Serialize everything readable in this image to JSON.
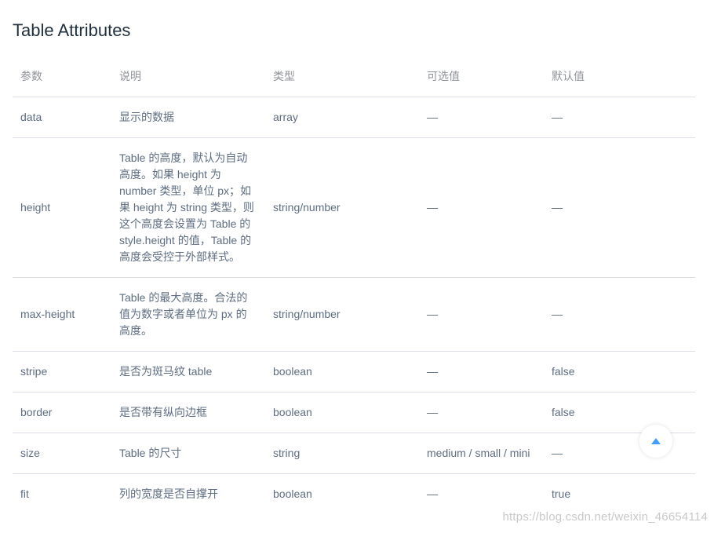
{
  "page": {
    "title": "Table Attributes",
    "watermark": "https://blog.csdn.net/weixin_46654114"
  },
  "table": {
    "headers": [
      "参数",
      "说明",
      "类型",
      "可选值",
      "默认值"
    ],
    "rows": [
      [
        "data",
        "显示的数据",
        "array",
        "—",
        "—"
      ],
      [
        "height",
        "Table 的高度，默认为自动高度。如果 height 为 number 类型，单位 px；如果 height 为 string 类型，则这个高度会设置为 Table 的 style.height 的值，Table 的高度会受控于外部样式。",
        "string/number",
        "—",
        "—"
      ],
      [
        "max-height",
        "Table 的最大高度。合法的值为数字或者单位为 px 的高度。",
        "string/number",
        "—",
        "—"
      ],
      [
        "stripe",
        "是否为斑马纹 table",
        "boolean",
        "—",
        "false"
      ],
      [
        "border",
        "是否带有纵向边框",
        "boolean",
        "—",
        "false"
      ],
      [
        "size",
        "Table 的尺寸",
        "string",
        "medium / small / mini",
        "—"
      ],
      [
        "fit",
        "列的宽度是否自撑开",
        "boolean",
        "—",
        "true"
      ]
    ]
  },
  "back_to_top": {
    "icon": "caret-up-icon",
    "color": "#409eff"
  }
}
